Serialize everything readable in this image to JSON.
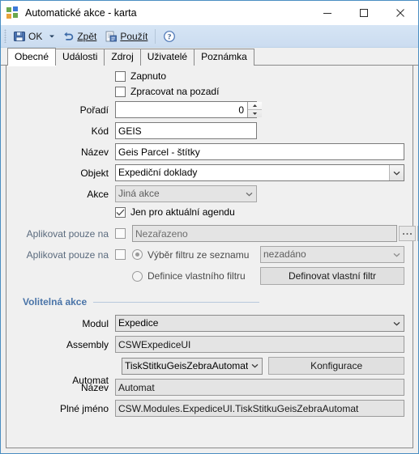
{
  "window": {
    "title": "Automatické akce - karta",
    "icon": "app-squares-icon",
    "minimize_label": "Minimalizovat",
    "maximize_label": "Maximalizovat",
    "close_label": "Zavřít"
  },
  "toolbar": {
    "ok_label": "OK",
    "ok_icon": "save-disk-icon",
    "ok_dropdown_icon": "chevron-down-icon",
    "back_label": "Zpět",
    "back_icon": "undo-arrow-icon",
    "apply_label": "Použít",
    "apply_icon": "apply-document-icon",
    "help_icon": "help-question-icon",
    "help_label": "Nápověda"
  },
  "tabs": [
    {
      "label": "Obecné",
      "active": true
    },
    {
      "label": "Události",
      "active": false
    },
    {
      "label": "Zdroj",
      "active": false
    },
    {
      "label": "Uživatelé",
      "active": false
    },
    {
      "label": "Poznámka",
      "active": false
    }
  ],
  "form": {
    "enabled_checkbox": {
      "label": "Zapnuto",
      "checked": false
    },
    "background_checkbox": {
      "label": "Zpracovat na pozadí",
      "checked": false
    },
    "order": {
      "label": "Pořadí",
      "value": "0"
    },
    "code": {
      "label": "Kód",
      "value": "GEIS"
    },
    "name": {
      "label": "Název",
      "value": "Geis Parcel - štítky"
    },
    "object": {
      "label": "Objekt",
      "value": "Expediční doklady"
    },
    "action": {
      "label": "Akce",
      "value": "Jiná akce"
    },
    "current_agenda_checkbox": {
      "label": "Jen pro aktuální agendu",
      "checked": true
    },
    "apply_only_1": {
      "label": "Aplikovat pouze na",
      "value": "Nezařazeno",
      "ellipsis_label": "...",
      "grid_icon": "grid-table-icon"
    },
    "apply_only_2": {
      "label": "Aplikovat pouze na"
    },
    "filter_from_list": {
      "label": "Výběr filtru ze seznamu",
      "selected": true,
      "value": "nezadáno"
    },
    "custom_filter": {
      "label": "Definice vlastního filtru",
      "selected": false,
      "button_label": "Definovat vlastní filtr"
    }
  },
  "optional_action": {
    "group_title": "Volitelná akce",
    "module": {
      "label": "Modul",
      "value": "Expedice"
    },
    "assembly": {
      "label": "Assembly",
      "value": "CSWExpediceUI"
    },
    "automat": {
      "label": "Automat",
      "value": "TiskStitkuGeisZebraAutomat",
      "button_label": "Konfigurace"
    },
    "name": {
      "label": "Název",
      "value": "Automat"
    },
    "full_name": {
      "label": "Plné jméno",
      "value": "CSW.Modules.ExpediceUI.TiskStitkuGeisZebraAutomat"
    }
  },
  "colors": {
    "window_border": "#4a8ec2",
    "toolbar_top": "#d6e5f5",
    "group_title": "#4a74a8",
    "disabled_label": "#5a6a7d",
    "readonly_field": "#e4e4e4"
  }
}
